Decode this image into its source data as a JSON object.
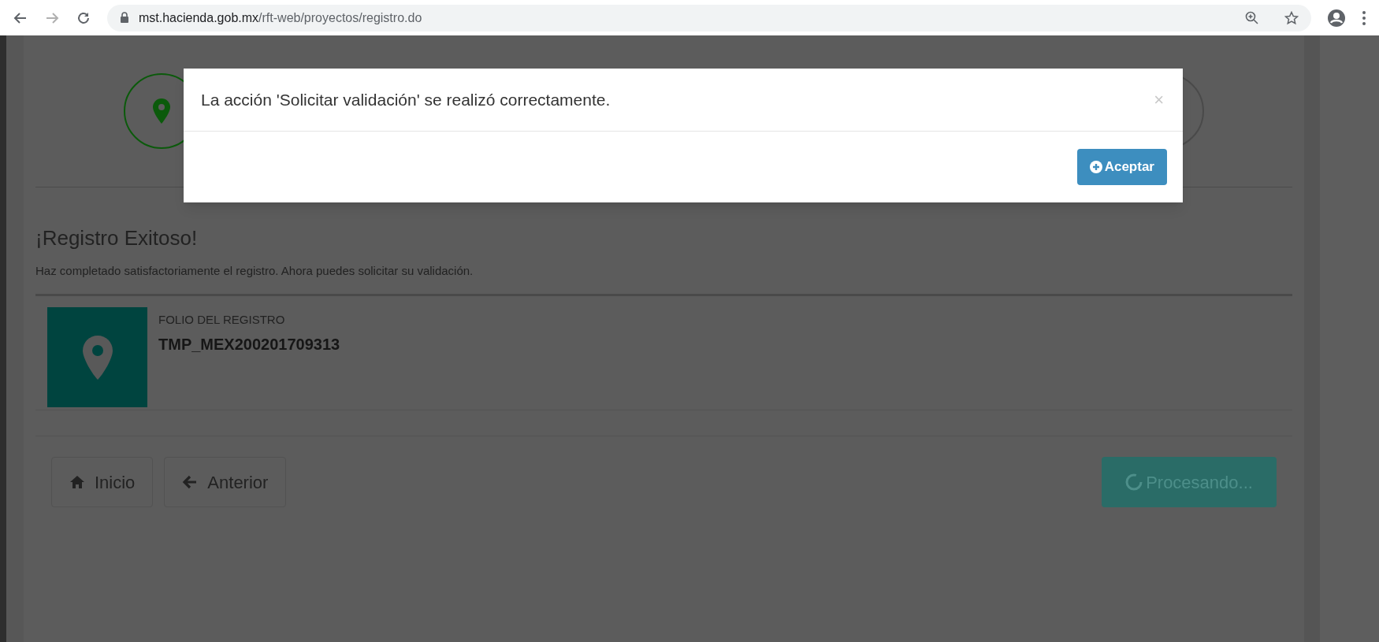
{
  "browser": {
    "url_host": "mst.hacienda.gob.mx",
    "url_path": "/rft-web/proyectos/registro.do"
  },
  "steps": [
    {
      "completed": true
    },
    {
      "completed": false
    }
  ],
  "heading": "¡Registro Exitoso!",
  "description": "Haz completado satisfactoriamente el registro. Ahora puedes solicitar su validación.",
  "folio": {
    "label": "FOLIO DEL REGISTRO",
    "value": "TMP_MEX200201709313"
  },
  "nav_buttons": [
    "Inicio",
    "Anterior"
  ],
  "process_button": "Procesando...",
  "modal": {
    "message": "La acción 'Solicitar validación' se realizó correctamente.",
    "close": "×",
    "button": "Aceptar"
  }
}
